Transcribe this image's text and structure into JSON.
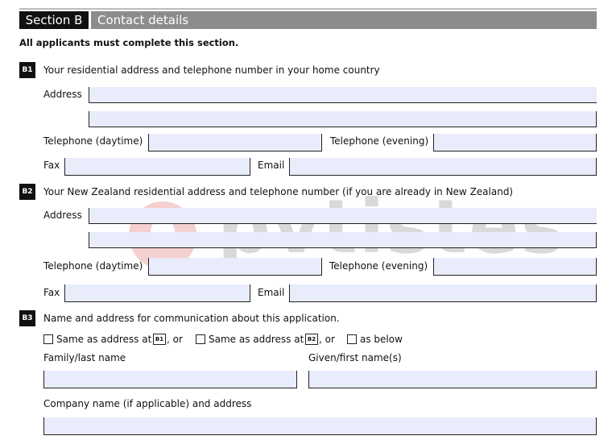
{
  "section": {
    "number": "Section B",
    "title": "Contact details"
  },
  "intro": "All applicants must complete this section.",
  "b1": {
    "badge": "B1",
    "question": "Your residential address and telephone number in your home country",
    "address_label": "Address",
    "tel_day_label": "Telephone (daytime)",
    "tel_eve_label": "Telephone (evening)",
    "fax_label": "Fax",
    "email_label": "Email"
  },
  "b2": {
    "badge": "B2",
    "question": "Your New Zealand residential address and telephone number (if you are already in New Zealand)",
    "address_label": "Address",
    "tel_day_label": "Telephone (daytime)",
    "tel_eve_label": "Telephone (evening)",
    "fax_label": "Fax",
    "email_label": "Email"
  },
  "b3": {
    "badge": "B3",
    "question": "Name and address for communication about this application.",
    "opt1_text": "Same as address at",
    "opt1_ref": "B1",
    "opt1_suffix": ", or",
    "opt2_text": "Same as address at",
    "opt2_ref": "B2",
    "opt2_suffix": ", or",
    "opt3_text": "as below",
    "family_label": "Family/last name",
    "given_label": "Given/first name(s)",
    "company_label": "Company name (if applicable) and address"
  },
  "watermark": {
    "text": "pvtistes"
  }
}
